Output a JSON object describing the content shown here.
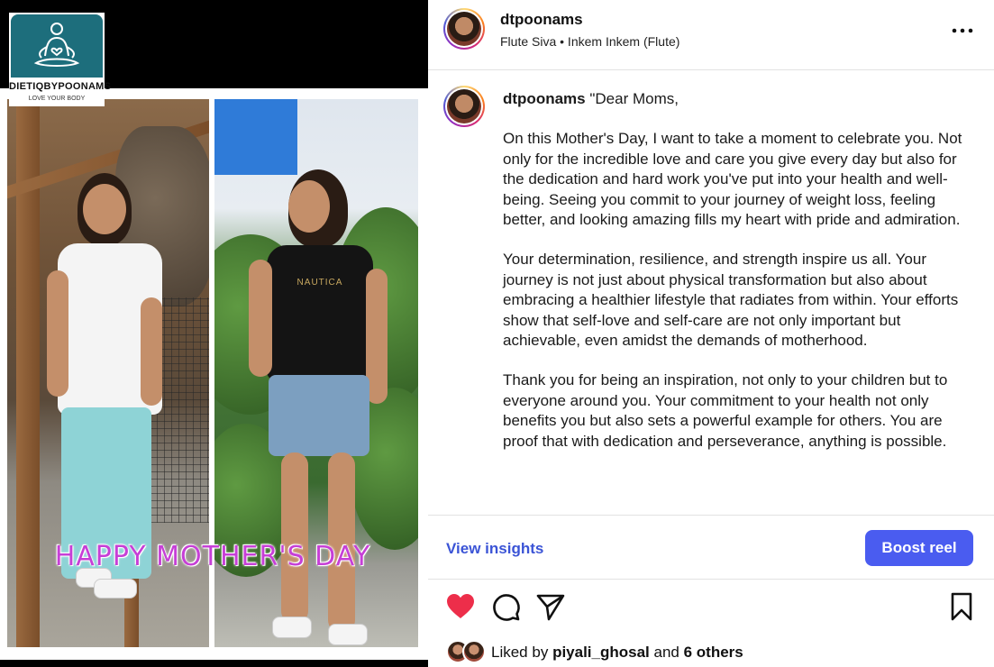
{
  "brand": {
    "name": "DIETIQBYPOONAMS",
    "tagline": "LOVE YOUR BODY"
  },
  "media": {
    "overlay_text": "HAPPY MOTHER'S DAY",
    "shirt_text": "NAUTICA"
  },
  "header": {
    "username": "dtpoonams",
    "audio": "Flute Siva • Inkem Inkem (Flute)",
    "more_icon": "more-horizontal-icon"
  },
  "caption": {
    "username": "dtpoonams",
    "opening": "\"Dear Moms,",
    "paragraphs": [
      "On this Mother's Day, I want to take a moment to celebrate you. Not only for the incredible love and care you give every day but also for the dedication and hard work you've put into your health and well-being. Seeing you commit to your journey of weight loss, feeling better, and looking amazing fills my heart with pride and admiration.",
      "Your determination, resilience, and strength inspire us all. Your journey is not just about physical transformation but also about embracing a healthier lifestyle that radiates from within. Your efforts show that self-love and self-care are not only important but achievable, even amidst the demands of motherhood.",
      "Thank you for being an inspiration, not only to your children but to everyone around you. Your commitment to your health not only benefits you but also sets a powerful example for others. You are proof that with dedication and perseverance, anything is possible."
    ]
  },
  "insights": {
    "link_label": "View insights",
    "boost_label": "Boost reel",
    "accent": "#4a5cf0",
    "link_color": "#3b54d6"
  },
  "actions": {
    "like_icon": "heart-filled-icon",
    "comment_icon": "comment-icon",
    "share_icon": "send-icon",
    "save_icon": "bookmark-icon",
    "like_color": "#ed2e4a"
  },
  "likes": {
    "prefix": "Liked by",
    "user": "piyali_ghosal",
    "connector": "and",
    "others": "6 others"
  }
}
